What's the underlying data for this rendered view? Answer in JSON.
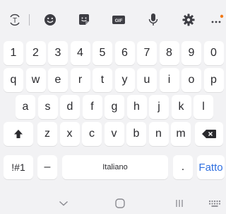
{
  "toolbar": {
    "icons": [
      "translate-icon",
      "emoji-icon",
      "sticker-icon",
      "gif-icon",
      "mic-icon",
      "gear-icon",
      "more-icon"
    ],
    "gif_label": "GIF",
    "more_label": "...",
    "notification_color": "#f07a1a"
  },
  "keys": {
    "row1": [
      "1",
      "2",
      "3",
      "4",
      "5",
      "6",
      "7",
      "8",
      "9",
      "0"
    ],
    "row2": [
      "q",
      "w",
      "e",
      "r",
      "t",
      "y",
      "u",
      "i",
      "o",
      "p"
    ],
    "row3": [
      "a",
      "s",
      "d",
      "f",
      "g",
      "h",
      "j",
      "k",
      "l"
    ],
    "row4": [
      "z",
      "x",
      "c",
      "v",
      "b",
      "n",
      "m"
    ],
    "symbols": "!#1",
    "dash": "–",
    "space": "Italiano",
    "period": ".",
    "done": "Fatto"
  },
  "navbar": {
    "icons": [
      "chevron-down-icon",
      "home-icon",
      "recents-icon",
      "keyboard-icon"
    ]
  },
  "colors": {
    "background": "#f2f2f4",
    "key": "#ffffff",
    "accent": "#2f6fe0"
  }
}
